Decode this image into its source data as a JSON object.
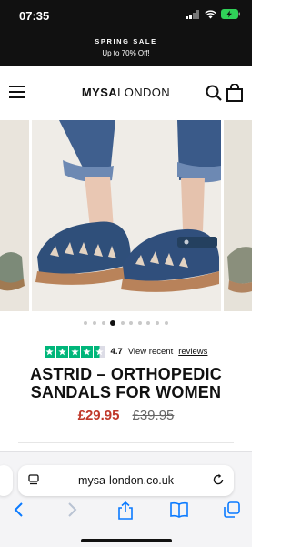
{
  "status_bar": {
    "time": "07:35"
  },
  "promo": {
    "title": "SPRING SALE",
    "subtitle": "Up to 70% Off!"
  },
  "header": {
    "logo_bold": "MYSA",
    "logo_light": "LONDON"
  },
  "carousel": {
    "slide_count": 10,
    "active_index": 3
  },
  "rating": {
    "value": "4.7",
    "prefix": "View recent",
    "link": "reviews",
    "stars": 4.5,
    "star_color": "#00b67a"
  },
  "product": {
    "title_line1": "ASTRID – ORTHOPEDIC",
    "title_line2": "SANDALS FOR WOMEN",
    "price": "£29.95",
    "old_price": "£39.95",
    "sale_color": "#c0392b"
  },
  "browser": {
    "url": "mysa-london.co.uk"
  },
  "icons": [
    "menu-icon",
    "search-icon",
    "bag-icon",
    "trustpilot-star-icon",
    "reload-icon",
    "back-icon",
    "forward-icon",
    "share-icon",
    "bookmarks-icon",
    "tabs-icon"
  ]
}
